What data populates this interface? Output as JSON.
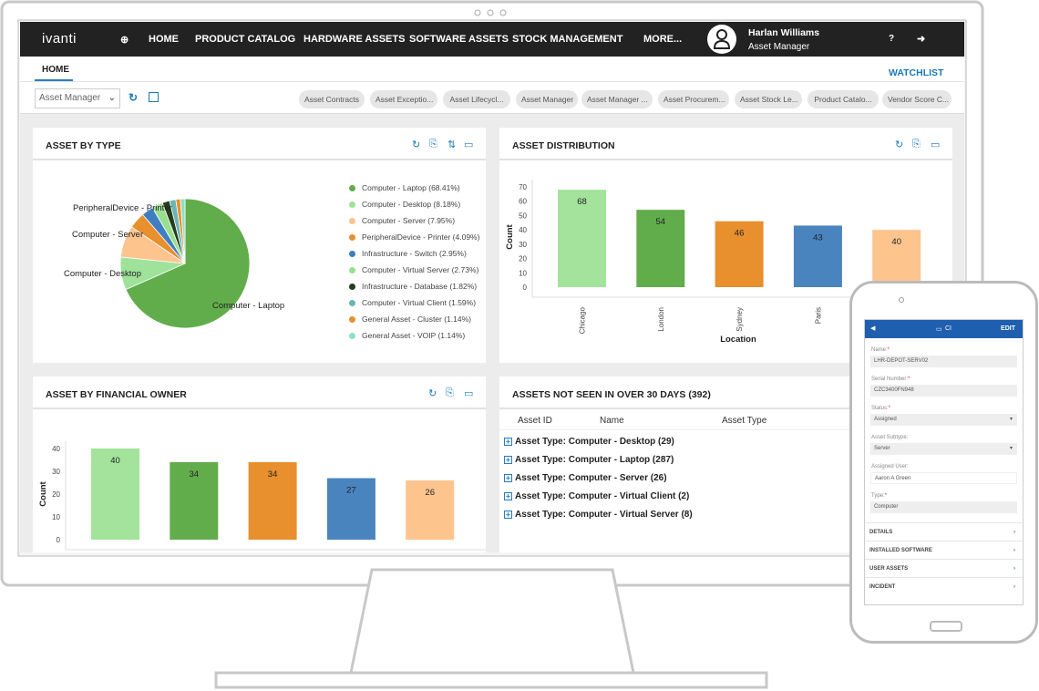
{
  "nav": {
    "logo": "ivanti",
    "items": [
      "HOME",
      "PRODUCT CATALOG",
      "HARDWARE ASSETS",
      "SOFTWARE ASSETS",
      "STOCK MANAGEMENT",
      "MORE..."
    ],
    "user_name": "Harlan Williams",
    "user_role": "Asset Manager"
  },
  "tabs": {
    "active": "HOME",
    "watchlist": "WATCHLIST"
  },
  "toolbar": {
    "role_select": "Asset Manager",
    "chips": [
      "Asset Contracts",
      "Asset Exceptio...",
      "Asset Lifecycl...",
      "Asset Manager",
      "Asset Manager ...",
      "Asset Procurem...",
      "Asset Stock Le...",
      "Product Catalo...",
      "Vendor Score C..."
    ]
  },
  "panels": {
    "asset_by_type": "ASSET BY TYPE",
    "asset_distribution": "ASSET DISTRIBUTION",
    "asset_by_financial_owner": "ASSET BY FINANCIAL OWNER",
    "assets_not_seen": "ASSETS NOT SEEN IN OVER 30 DAYS (392)"
  },
  "assets_not_seen": {
    "columns": [
      "Asset ID",
      "Name",
      "Asset Type"
    ],
    "groups": [
      "Asset Type: Computer - Desktop (29)",
      "Asset Type: Computer - Laptop (287)",
      "Asset Type: Computer - Server (26)",
      "Asset Type: Computer - Virtual Client (2)",
      "Asset Type: Computer - Virtual Server (8)"
    ]
  },
  "chart_data": [
    {
      "type": "pie",
      "title": "ASSET BY TYPE",
      "legend": "right",
      "slices": [
        {
          "name": "Computer - Laptop",
          "value": 68.41,
          "label": "Computer - Laptop (68.41%)",
          "color": "#62ad4b"
        },
        {
          "name": "Computer - Desktop",
          "value": 8.18,
          "label": "Computer - Desktop (8.18%)",
          "color": "#9fe29a"
        },
        {
          "name": "Computer - Server",
          "value": 7.95,
          "label": "Computer - Server (7.95%)",
          "color": "#fdc48e"
        },
        {
          "name": "PeripheralDevice - Printer",
          "value": 4.09,
          "label": "PeripheralDevice - Printer (4.09%)",
          "color": "#e88f2e"
        },
        {
          "name": "Infrastructure - Switch",
          "value": 2.95,
          "label": "Infrastructure - Switch (2.95%)",
          "color": "#3f7fc0"
        },
        {
          "name": "Computer - Virtual Server",
          "value": 2.73,
          "label": "Computer - Virtual Server (2.73%)",
          "color": "#98e08f"
        },
        {
          "name": "Infrastructure - Database",
          "value": 1.82,
          "label": "Infrastructure - Database (1.82%)",
          "color": "#253d1c"
        },
        {
          "name": "Computer - Virtual Client",
          "value": 1.59,
          "label": "Computer - Virtual Client (1.59%)",
          "color": "#6ab5b5"
        },
        {
          "name": "General Asset - Cluster",
          "value": 1.14,
          "label": "General Asset - Cluster (1.14%)",
          "color": "#e88f2e"
        },
        {
          "name": "General Asset - VOIP",
          "value": 1.14,
          "label": "General Asset - VOIP (1.14%)",
          "color": "#8de0c4"
        }
      ],
      "slice_labels": [
        "Computer - Laptop",
        "Computer - Desktop",
        "Computer - Server",
        "PeripheralDevice - Printer"
      ]
    },
    {
      "type": "bar",
      "title": "ASSET DISTRIBUTION",
      "xlabel": "Location",
      "ylabel": "Count",
      "ylim": [
        0,
        70
      ],
      "yticks": [
        0,
        10,
        20,
        30,
        40,
        50,
        60,
        70
      ],
      "categories": [
        "Chicago",
        "London",
        "Sydney",
        "Paris",
        ""
      ],
      "values": [
        68,
        54,
        46,
        43,
        40
      ],
      "colors": [
        "#a3e39b",
        "#62ad4b",
        "#e88f2e",
        "#4a84bf",
        "#fdc48e"
      ]
    },
    {
      "type": "bar",
      "title": "ASSET BY FINANCIAL OWNER",
      "ylabel": "Count",
      "ylim": [
        0,
        40
      ],
      "yticks": [
        0,
        10,
        20,
        30,
        40
      ],
      "categories": [
        "",
        "",
        "",
        "",
        ""
      ],
      "values": [
        40,
        34,
        34,
        27,
        26
      ],
      "colors": [
        "#a3e39b",
        "#62ad4b",
        "#e88f2e",
        "#4a84bf",
        "#fdc48e"
      ]
    }
  ],
  "phone": {
    "title": "CI",
    "edit": "EDIT",
    "fields": [
      {
        "label": "Name:",
        "required": true,
        "value": "LHR-DEPOT-SERV02"
      },
      {
        "label": "Serial Number:",
        "required": true,
        "value": "CZC3400FN948"
      },
      {
        "label": "Status:",
        "required": true,
        "value": "Assigned",
        "select": true
      },
      {
        "label": "Asset Subtype:",
        "required": false,
        "value": "Server",
        "select": true
      },
      {
        "label": "Assigned User:",
        "required": false,
        "value": "Aaron A Green"
      },
      {
        "label": "Type:",
        "required": true,
        "value": "Computer"
      }
    ],
    "sections": [
      "DETAILS",
      "INSTALLED SOFTWARE",
      "USER ASSETS",
      "INCIDENT"
    ]
  }
}
